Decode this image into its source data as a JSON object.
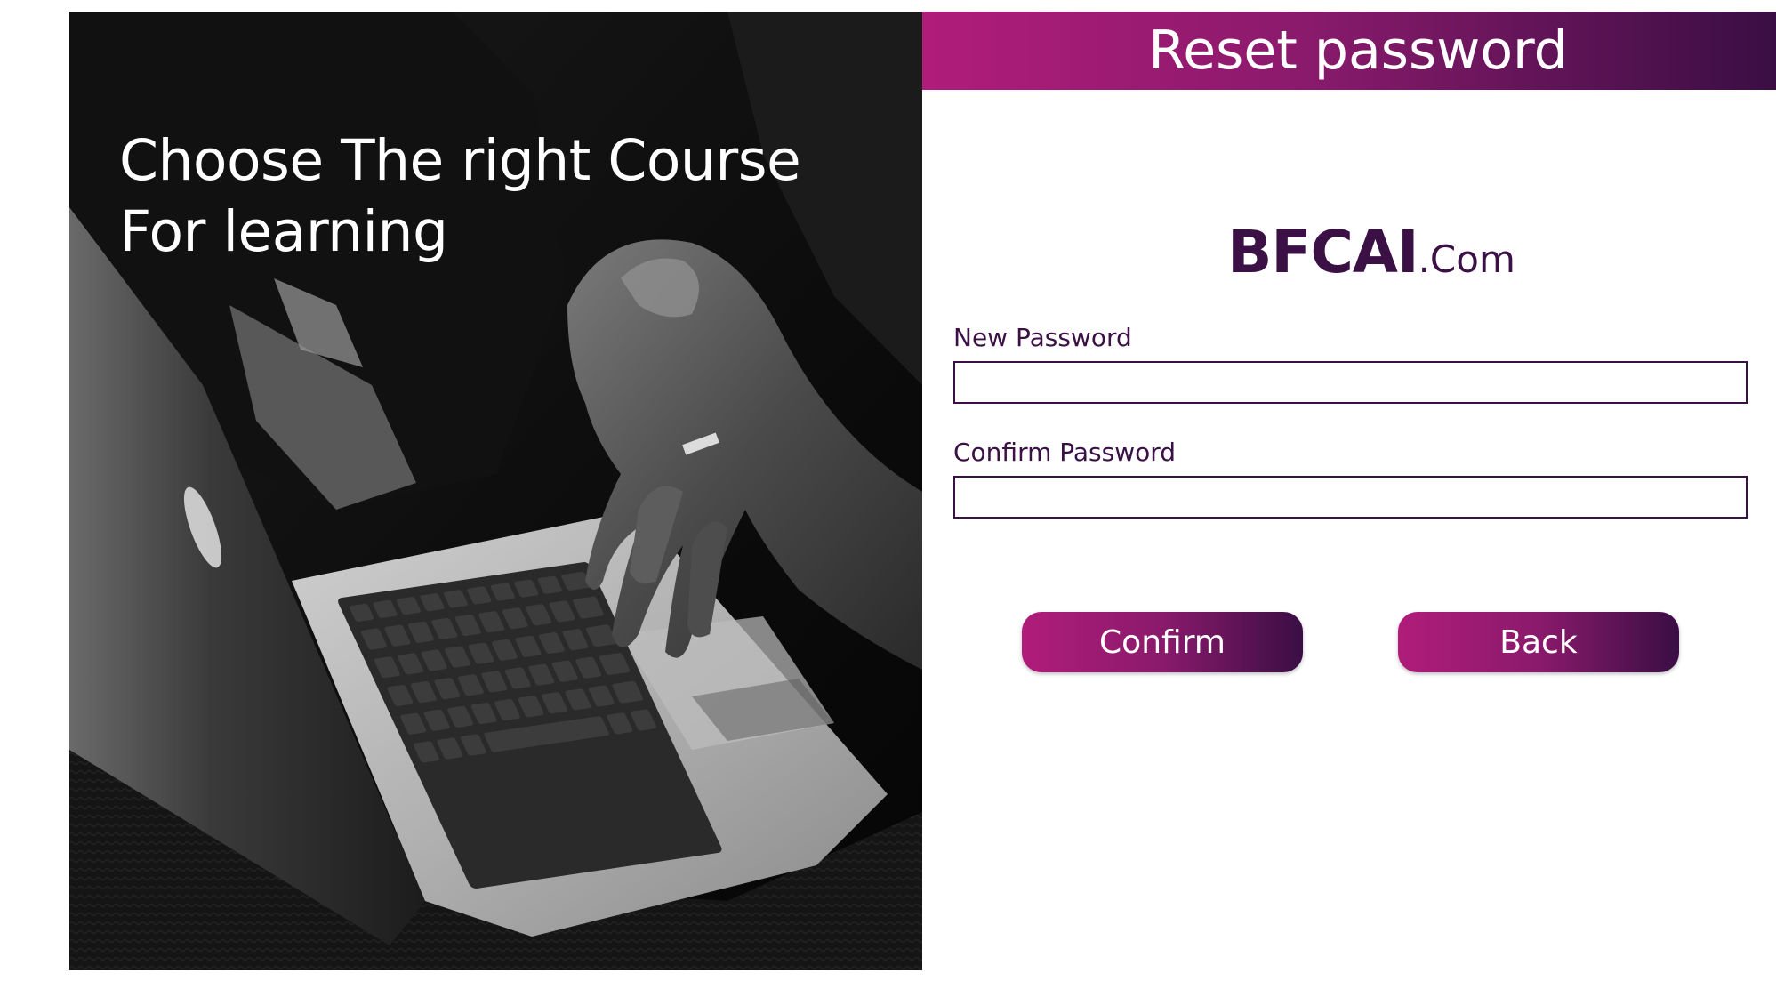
{
  "hero": {
    "heading_line1": "Choose The right Course",
    "heading_line2": "For learning"
  },
  "header": {
    "title": "Reset password"
  },
  "brand": {
    "main": "BFCAI",
    "suffix": ".Com"
  },
  "form": {
    "new_password_label": "New Password",
    "new_password_value": "",
    "confirm_password_label": "Confirm Password",
    "confirm_password_value": ""
  },
  "actions": {
    "confirm_label": "Confirm",
    "back_label": "Back"
  },
  "colors": {
    "accent_start": "#b01c7a",
    "accent_end": "#3a0e44",
    "brand_text": "#3a1045"
  }
}
